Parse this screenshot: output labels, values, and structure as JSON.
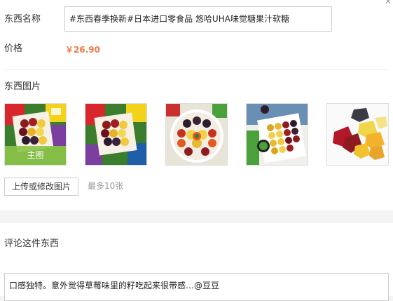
{
  "product": {
    "name_label": "东西名称",
    "name_value": "#东西春季换新#日本进口零食品 悠哈UHA味觉糖果汁软糖",
    "price_label": "价格",
    "price_value": "￥26.90"
  },
  "images": {
    "section_label": "东西图片",
    "main_badge": "主图",
    "items": [
      {
        "icon": "candy-box-photo",
        "main": true
      },
      {
        "icon": "candy-box-photo",
        "main": false
      },
      {
        "icon": "candy-plate-photo",
        "main": false
      },
      {
        "icon": "candy-tray-photo",
        "main": false
      },
      {
        "icon": "gummy-pile-photo",
        "main": false
      }
    ],
    "upload_button": "上传或修改图片",
    "max_hint": "最多10张"
  },
  "comment": {
    "section_label": "评论这件东西",
    "value": "口感独特。意外觉得草莓味里的籽吃起来很带感…@豆豆"
  },
  "close_icon": "close-icon",
  "colors": {
    "price": "#f07a4a",
    "main_badge": "#8bc34a",
    "border": "#cccccc",
    "page_bg": "#f4f4f4"
  }
}
